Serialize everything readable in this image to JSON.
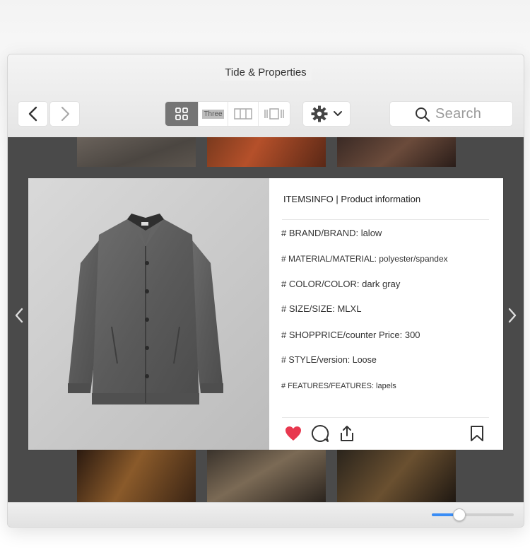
{
  "window": {
    "title": "Tide & Properties"
  },
  "toolbar": {
    "view_three_label": "Three",
    "search_placeholder": "Search"
  },
  "product": {
    "header": "ITEMSINFO | Product information",
    "properties": [
      "# BRAND/BRAND: lalow",
      "# MATERIAL/MATERIAL: polyester/spandex",
      "# COLOR/COLOR: dark gray",
      "# SIZE/SIZE: MLXL",
      "# SHOPPRICE/counter Price: 300",
      "# STYLE/version: Loose",
      "# FEATURES/FEATURES: lapels"
    ],
    "liked": true
  },
  "zoom_slider": {
    "value": 0.33
  },
  "colors": {
    "accent": "#3a8df5",
    "like": "#e8384f",
    "background_dark": "#4a4a4a"
  }
}
